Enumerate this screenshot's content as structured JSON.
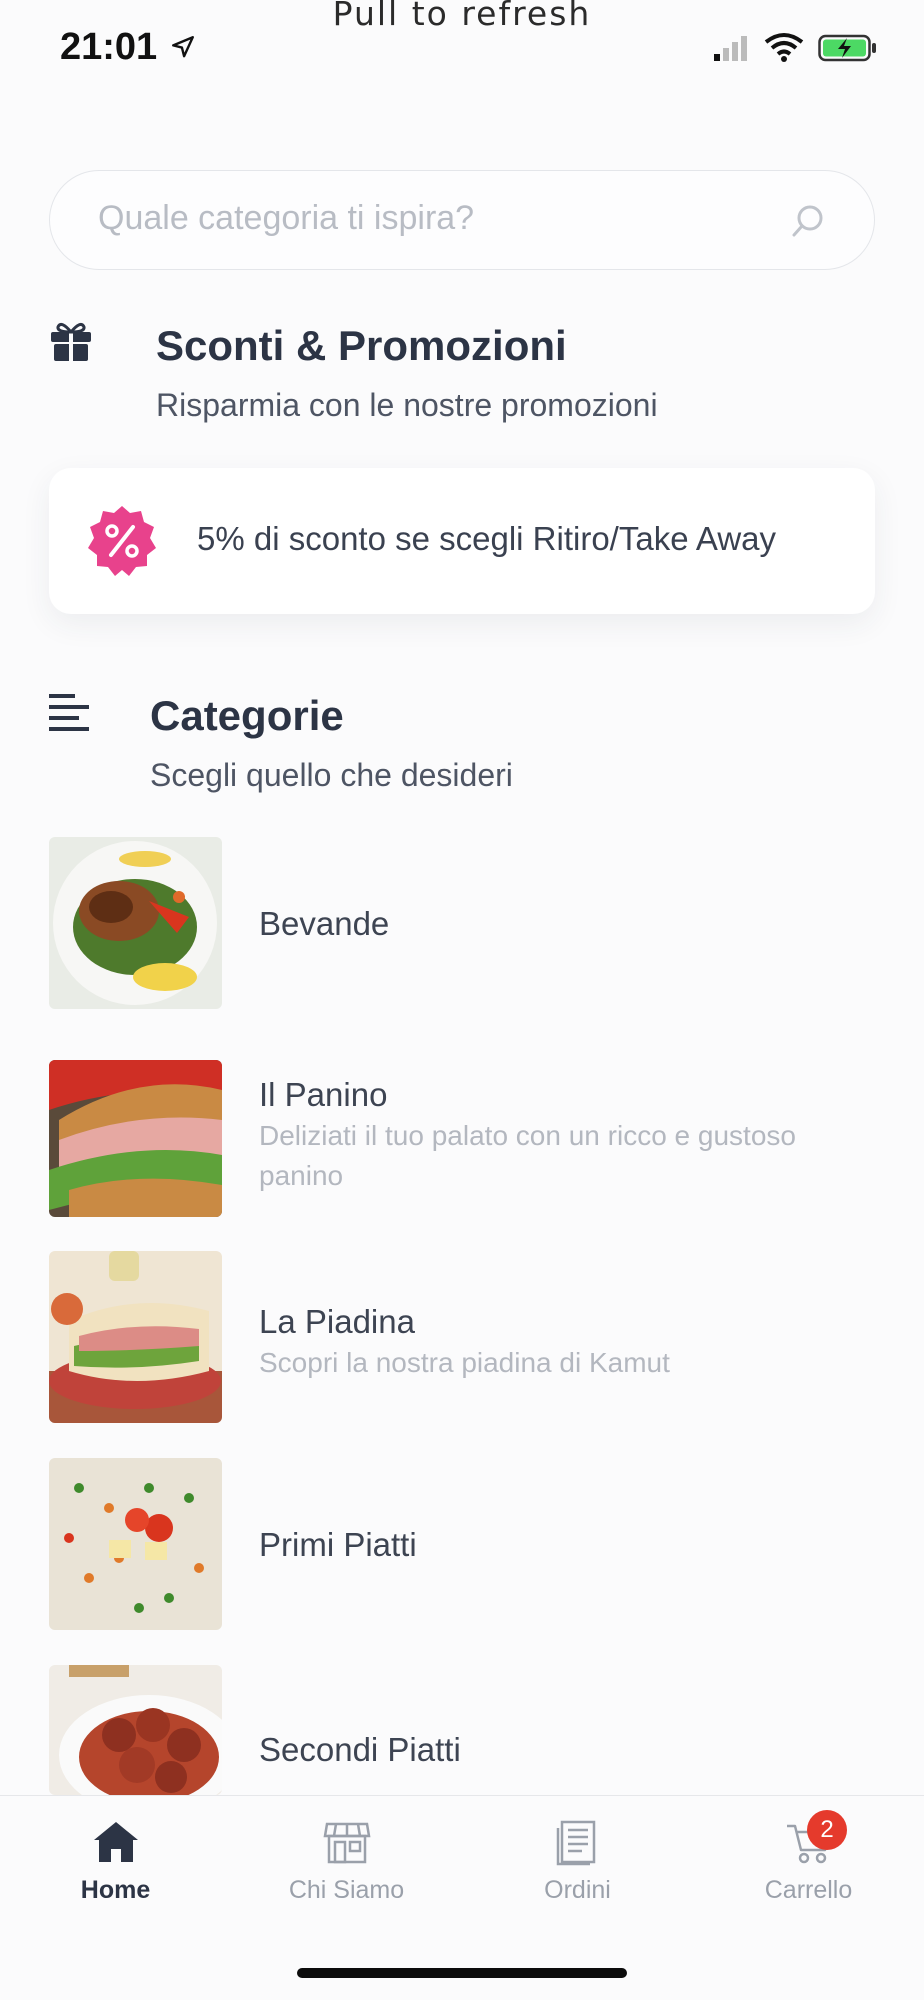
{
  "status_bar": {
    "time": "21:01",
    "pull_hint": "Pull to refresh"
  },
  "search": {
    "placeholder": "Quale categoria ti ispira?"
  },
  "promotions": {
    "title": "Sconti & Promozioni",
    "subtitle": "Risparmia con le nostre promozioni",
    "items": [
      {
        "text": "5% di sconto se scegli Ritiro/Take Away",
        "badge_color": "#e8428c"
      }
    ]
  },
  "categories": {
    "title": "Categorie",
    "subtitle": "Scegli quello che desideri",
    "items": [
      {
        "name": "Bevande",
        "description": ""
      },
      {
        "name": "Il Panino",
        "description": "Deliziati il tuo palato con un ricco e gustoso panino"
      },
      {
        "name": "La Piadina",
        "description": "Scopri la nostra piadina di Kamut"
      },
      {
        "name": "Primi Piatti",
        "description": ""
      },
      {
        "name": "Secondi Piatti",
        "description": ""
      }
    ]
  },
  "tabbar": {
    "items": [
      {
        "label": "Home",
        "icon": "home-icon",
        "active": true
      },
      {
        "label": "Chi Siamo",
        "icon": "store-icon",
        "active": false
      },
      {
        "label": "Ordini",
        "icon": "receipt-icon",
        "active": false
      },
      {
        "label": "Carrello",
        "icon": "cart-icon",
        "active": false
      }
    ],
    "cart_count": "2"
  },
  "colors": {
    "primary_text": "#2c3445",
    "accent_pink": "#e8428c",
    "badge_red": "#e53a2c"
  }
}
